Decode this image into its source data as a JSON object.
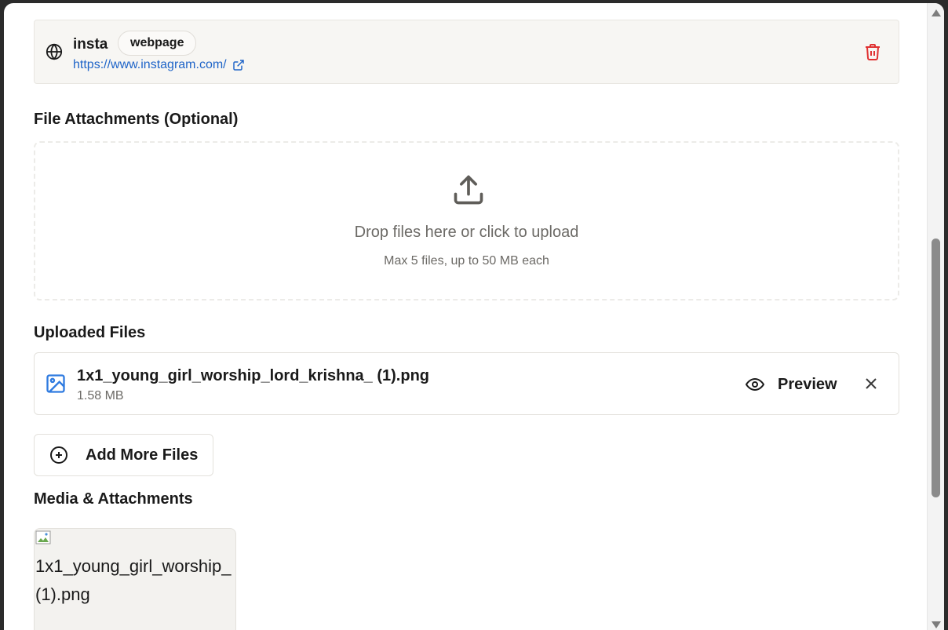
{
  "link": {
    "title": "insta",
    "type_badge": "webpage",
    "url": "https://www.instagram.com/",
    "icon": "globe-icon",
    "delete_icon": "trash-icon",
    "delete_color": "#e03131"
  },
  "attachments": {
    "section_label": "File Attachments (Optional)",
    "drop_text": "Drop files here or click to upload",
    "drop_subtext": "Max 5 files, up to 50 MB each",
    "upload_icon": "upload-icon"
  },
  "uploaded": {
    "section_label": "Uploaded Files",
    "files": [
      {
        "name": "1x1_young_girl_worship_lord_krishna_ (1).png",
        "size": "1.58 MB",
        "icon": "image-file-icon",
        "preview_label": "Preview"
      }
    ],
    "add_more_label": "Add More Files"
  },
  "media": {
    "section_label": "Media & Attachments",
    "items": [
      {
        "alt_line1": "1x1_young_girl_worship_",
        "alt_line2": "(1).png"
      }
    ]
  },
  "colors": {
    "link_blue": "#1e64c8",
    "muted_text": "#6c6a66",
    "image_icon_blue": "#2f7be0"
  }
}
